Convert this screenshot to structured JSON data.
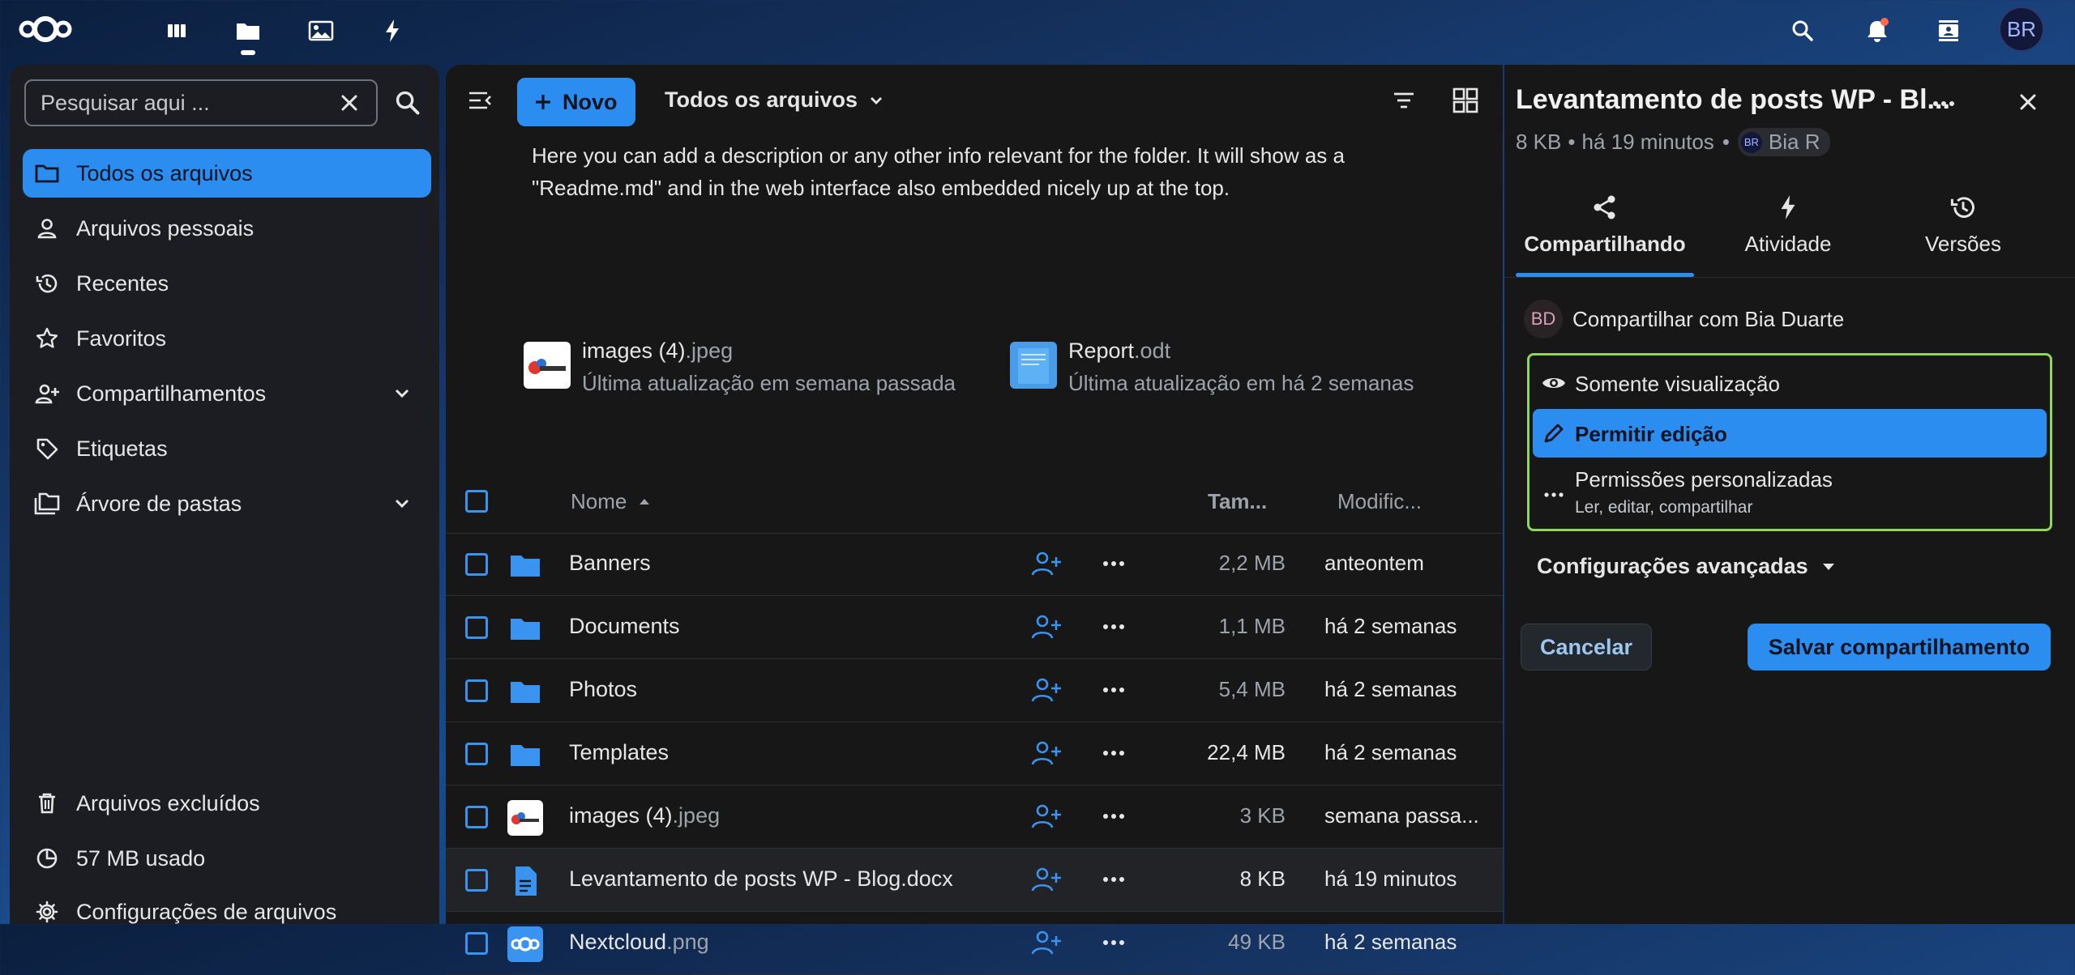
{
  "topbar": {
    "apps": [
      "dashboard-icon",
      "files-icon",
      "photos-icon",
      "activity-icon"
    ],
    "active_app": "files",
    "user_initials": "BR"
  },
  "nav": {
    "search_placeholder": "Pesquisar aqui ...",
    "items": [
      {
        "label": "Todos os arquivos",
        "icon": "folder-icon",
        "active": true
      },
      {
        "label": "Arquivos pessoais",
        "icon": "user-icon"
      },
      {
        "label": "Recentes",
        "icon": "history-icon"
      },
      {
        "label": "Favoritos",
        "icon": "star-icon"
      },
      {
        "label": "Compartilhamentos",
        "icon": "share-user-icon",
        "expandable": true
      },
      {
        "label": "Etiquetas",
        "icon": "tag-icon"
      },
      {
        "label": "Árvore de pastas",
        "icon": "folder-tree-icon",
        "expandable": true
      }
    ],
    "bottom": {
      "trash": "Arquivos excluídos",
      "quota": "57 MB usado",
      "settings": "Configurações de arquivos"
    }
  },
  "main": {
    "new_button": "Novo",
    "breadcrumb": "Todos os arquivos",
    "readme": "Here you can add a description or any other info relevant for the folder. It will show as a \"Readme.md\" and in the web interface also embedded nicely up at the top.",
    "recent": [
      {
        "name": "images (4)",
        "ext": ".jpeg",
        "subtitle": "Última atualização em semana passada"
      },
      {
        "name": "Report",
        "ext": ".odt",
        "subtitle": "Última atualização em há 2 semanas"
      }
    ],
    "columns": {
      "name": "Nome",
      "size": "Tam...",
      "modified": "Modific..."
    },
    "files": [
      {
        "name": "Banners",
        "ext": "",
        "type": "folder",
        "size": "2,2 MB",
        "modified": "anteontem"
      },
      {
        "name": "Documents",
        "ext": "",
        "type": "folder",
        "size": "1,1 MB",
        "modified": "há 2 semanas"
      },
      {
        "name": "Photos",
        "ext": "",
        "type": "folder",
        "size": "5,4 MB",
        "modified": "há 2 semanas"
      },
      {
        "name": "Templates",
        "ext": "",
        "type": "folder",
        "size": "22,4 MB",
        "modified": "há 2 semanas"
      },
      {
        "name": "images (4)",
        "ext": ".jpeg",
        "type": "image",
        "size": "3 KB",
        "modified": "semana passa..."
      },
      {
        "name": "Levantamento de posts WP - Blog.docx",
        "ext": "",
        "type": "doc",
        "size": "8 KB",
        "modified": "há 19 minutos"
      },
      {
        "name": "Nextcloud",
        "ext": ".png",
        "type": "png",
        "size": "49 KB",
        "modified": "há 2 semanas"
      }
    ]
  },
  "sidebar": {
    "title": "Levantamento de posts WP - Bl...",
    "size": "8 KB",
    "time": "há 19 minutos",
    "owner": "Bia R",
    "owner_initials": "BR",
    "tabs": [
      {
        "label": "Compartilhando",
        "icon": "share-icon",
        "active": true
      },
      {
        "label": "Atividade",
        "icon": "activity-icon"
      },
      {
        "label": "Versões",
        "icon": "history-icon"
      }
    ],
    "share_with": "Compartilhar com Bia Duarte",
    "share_initials": "BD",
    "permissions": {
      "view_only": "Somente visualização",
      "allow_edit": "Permitir edição",
      "custom": "Permissões personalizadas",
      "custom_sub": "Ler, editar, compartilhar"
    },
    "advanced": "Configurações avançadas",
    "cancel": "Cancelar",
    "save": "Salvar compartilhamento"
  },
  "colors": {
    "accent": "#2c8df0",
    "panel": "#171717",
    "nav": "#1b1d22",
    "highlight_border": "#8fd65a"
  }
}
